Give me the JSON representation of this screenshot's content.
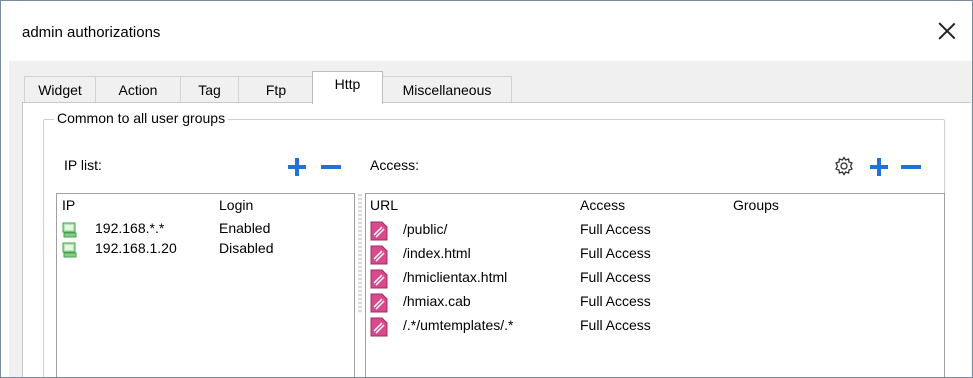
{
  "window": {
    "title": "admin authorizations"
  },
  "tabs": [
    {
      "label": "Widget"
    },
    {
      "label": "Action"
    },
    {
      "label": "Tag"
    },
    {
      "label": "Ftp"
    },
    {
      "label": "Http",
      "active": true
    },
    {
      "label": "Miscellaneous"
    }
  ],
  "group": {
    "title": "Common to all user groups"
  },
  "ip_list": {
    "label": "IP list:",
    "columns": [
      "IP",
      "Login"
    ],
    "rows": [
      {
        "ip": "192.168.*.*",
        "login": "Enabled"
      },
      {
        "ip": "192.168.1.20",
        "login": "Disabled"
      }
    ]
  },
  "access": {
    "label": "Access:",
    "columns": [
      "URL",
      "Access",
      "Groups"
    ],
    "rows": [
      {
        "url": "/public/",
        "access": "Full Access",
        "groups": ""
      },
      {
        "url": "/index.html",
        "access": "Full Access",
        "groups": ""
      },
      {
        "url": "/hmiclientax.html",
        "access": "Full Access",
        "groups": ""
      },
      {
        "url": "/hmiax.cab",
        "access": "Full Access",
        "groups": ""
      },
      {
        "url": "/.*/umtemplates/.*",
        "access": "Full Access",
        "groups": ""
      }
    ]
  },
  "icons": {
    "add": "plus-icon",
    "remove": "minus-icon",
    "settings": "gear-icon",
    "ip_row": "computer-icon",
    "url_row": "web-page-icon",
    "close": "close-icon"
  },
  "colors": {
    "accent": "#1e72d8",
    "page_icon": "#d94a8c",
    "pc_icon": "#3fa34d"
  }
}
